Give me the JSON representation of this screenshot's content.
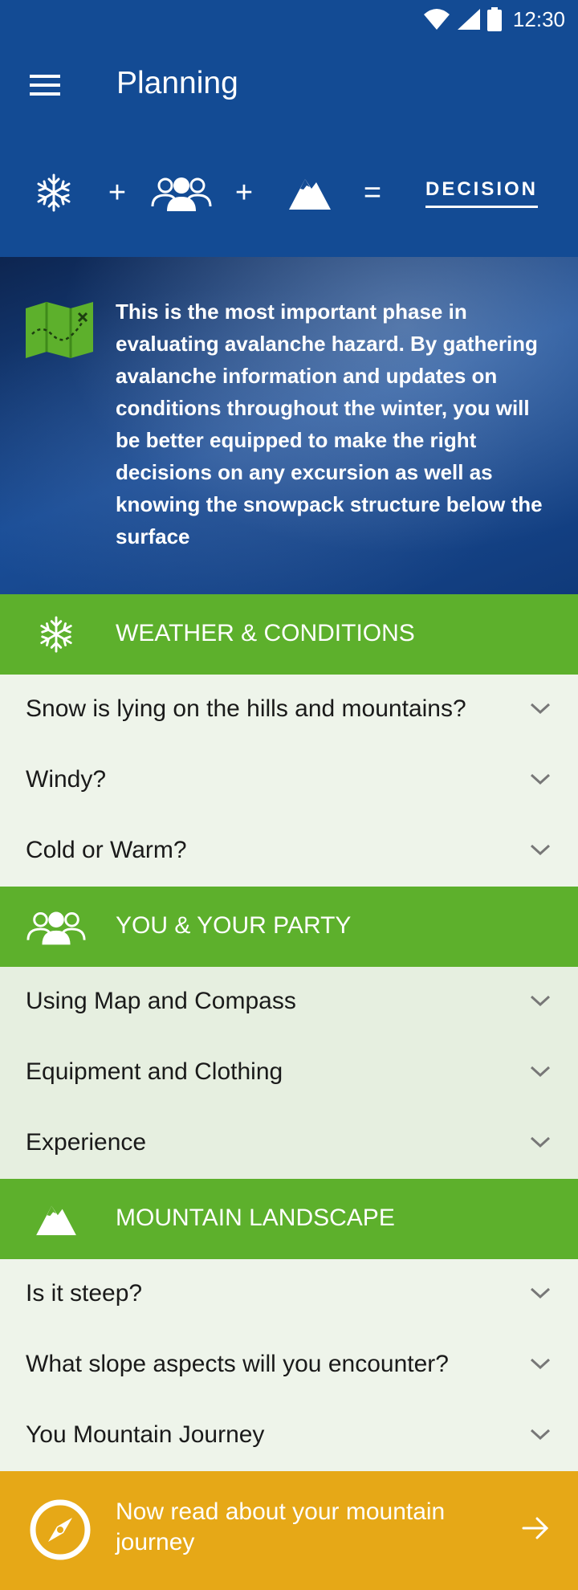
{
  "status_bar": {
    "time": "12:30"
  },
  "app_bar": {
    "title": "Planning",
    "formula": {
      "plus1": "+",
      "plus2": "+",
      "equals": "=",
      "result_label": "DECISION"
    }
  },
  "hero": {
    "text": "This is the most important phase in evaluating avalanche hazard. By gathering avalanche information and updates on conditions throughout the winter, you will be better equipped to make the right decisions on any excursion as well as knowing the snowpack structure below the surface"
  },
  "sections": [
    {
      "title": "WEATHER & CONDITIONS",
      "icon": "snowflake-icon",
      "items": [
        "Snow is lying on the hills and mountains?",
        "Windy?",
        "Cold or Warm?"
      ]
    },
    {
      "title": "YOU & YOUR PARTY",
      "icon": "group-icon",
      "items": [
        "Using Map and Compass",
        "Equipment and Clothing",
        "Experience"
      ]
    },
    {
      "title": "MOUNTAIN LANDSCAPE",
      "icon": "mountain-icon",
      "items": [
        "Is it steep?",
        "What slope aspects will you encounter?",
        "You Mountain Journey"
      ]
    }
  ],
  "footer": {
    "text": "Now read about your mountain journey",
    "icon": "compass-icon"
  },
  "colors": {
    "primary_blue": "#134b94",
    "section_green": "#5db02c",
    "footer_amber": "#e6a817"
  }
}
